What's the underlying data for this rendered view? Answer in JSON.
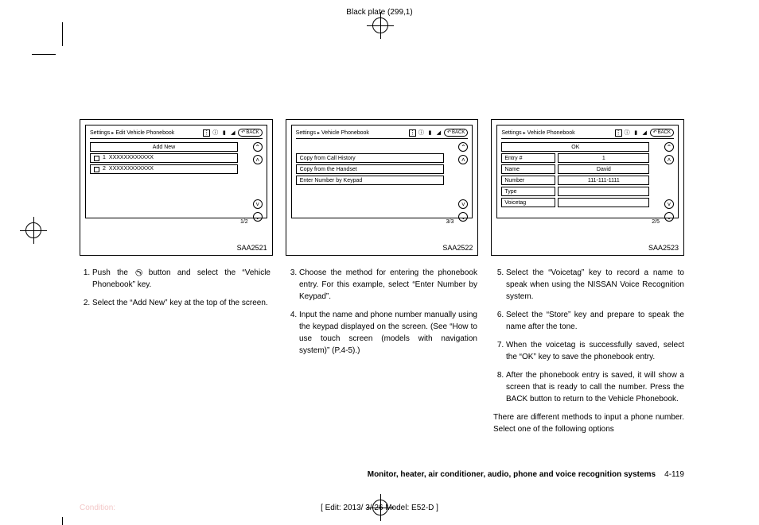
{
  "plate": "Black plate (299,1)",
  "figures": {
    "fig1": {
      "breadcrumb1": "Settings",
      "breadcrumb2": "Edit Vehicle Phonebook",
      "back": "BACK",
      "addNew": "Add New",
      "rows": [
        {
          "num": "1",
          "text": "XXXXXXXXXXXX"
        },
        {
          "num": "2",
          "text": "XXXXXXXXXXXX"
        }
      ],
      "pageInd": "1/2",
      "caption": "SAA2521"
    },
    "fig2": {
      "breadcrumb1": "Settings",
      "breadcrumb2": "Vehicle Phonebook",
      "back": "BACK",
      "rows": [
        "Copy from Call History",
        "Copy from the Handset",
        "Enter Number by Keypad"
      ],
      "pageInd": "3/3",
      "caption": "SAA2522"
    },
    "fig3": {
      "breadcrumb1": "Settings",
      "breadcrumb2": "Vehicle Phonebook",
      "back": "BACK",
      "ok": "OK",
      "fields": [
        {
          "k": "Entry #",
          "v": "1"
        },
        {
          "k": "Name",
          "v": "David"
        },
        {
          "k": "Number",
          "v": "111-111-1111"
        },
        {
          "k": "Type",
          "v": ""
        },
        {
          "k": "Voicetag",
          "v": ""
        }
      ],
      "pageInd": "2/5",
      "caption": "SAA2523"
    }
  },
  "col1": {
    "s1a": "Push the ",
    "s1b": " button and select the “Vehicle Phonebook” key.",
    "s2": "Select the “Add New” key at the top of the screen."
  },
  "col2": {
    "s3": "Choose the method for entering the phonebook entry. For this example, select “Enter Number by Keypad”.",
    "s4": "Input the name and phone number manually using the keypad displayed on the screen. (See “How to use touch screen (models with navigation system)” (P.4-5).)"
  },
  "col3": {
    "s5": "Select the “Voicetag” key to record a name to speak when using the NISSAN Voice Recognition system.",
    "s6": "Select the “Store” key and prepare to speak the name after the tone.",
    "s7": "When the voicetag is successfully saved, select the “OK” key to save the phonebook entry.",
    "s8": "After the phonebook entry is saved, it will show a screen that is ready to call the number. Press the BACK button to return to the Vehicle Phonebook.",
    "p": "There are different methods to input a phone number. Select one of the following options"
  },
  "footer": {
    "title": "Monitor, heater, air conditioner, audio, phone and voice recognition systems",
    "page": "4-119"
  },
  "edit": "[ Edit: 2013/ 3/ 26   Model: E52-D ]",
  "condition": "Condition:"
}
